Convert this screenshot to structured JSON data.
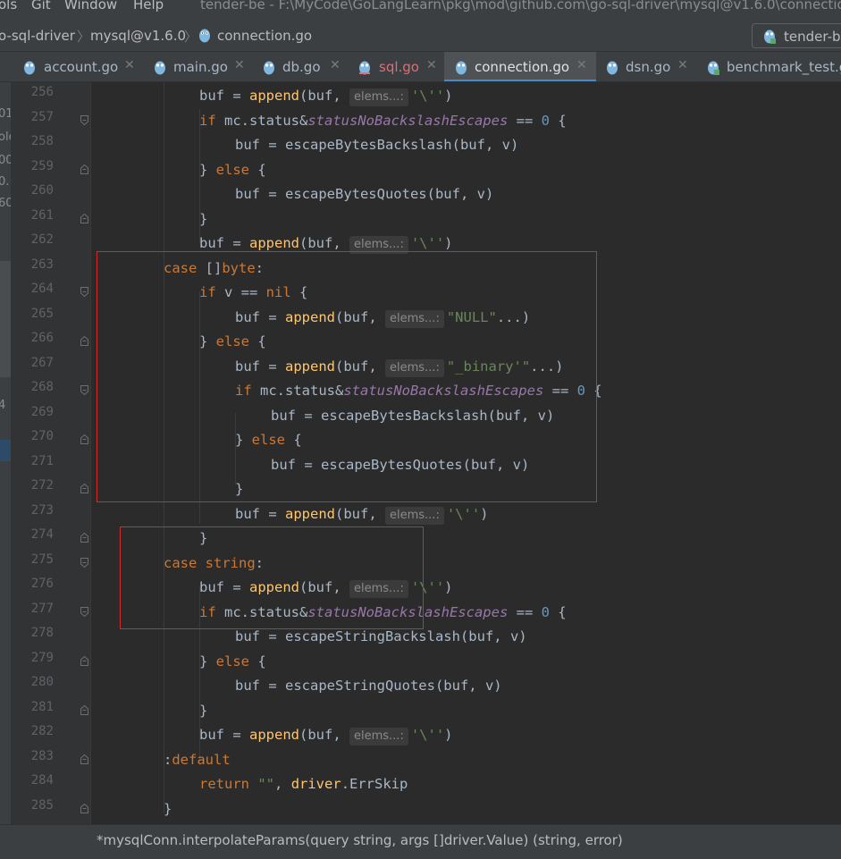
{
  "menu": {
    "items": [
      "ols",
      "Git",
      "Window",
      "Help"
    ],
    "window_title": "tender-be - F:\\MyCode\\GoLangLearn\\pkg\\mod\\github.com\\go-sql-driver\\mysql@v1.6.0\\connection.go"
  },
  "breadcrumb": {
    "items": [
      "o-sql-driver",
      "mysql@v1.6.0",
      "connection.go"
    ],
    "run_config": "tender-be"
  },
  "tabs": [
    {
      "label": "account.go",
      "active": false
    },
    {
      "label": "main.go",
      "active": false
    },
    {
      "label": "db.go",
      "active": false
    },
    {
      "label": "sql.go",
      "active": false,
      "error": true
    },
    {
      "label": "connection.go",
      "active": true
    },
    {
      "label": "dsn.go",
      "active": false
    },
    {
      "label": "benchmark_test.go",
      "active": false
    }
  ],
  "left_strip_fragments": [
    "01",
    "ole",
    "00",
    "0.",
    "60",
    "4"
  ],
  "line_numbers": [
    "256",
    "257",
    "258",
    "259",
    "260",
    "261",
    "262",
    "263",
    "264",
    "265",
    "266",
    "267",
    "268",
    "269",
    "270",
    "271",
    "272",
    "273",
    "274",
    "275",
    "276",
    "277",
    "278",
    "279",
    "280",
    "281",
    "282",
    "283",
    "284",
    "285"
  ],
  "inlay_hint": "elems...:",
  "code": {
    "l256": {
      "a": "buf = ",
      "fn": "append",
      "b": "(buf, ",
      "str": "'\\''",
      "c": ")"
    },
    "l257": {
      "kw": "if",
      "a": " mc.status&",
      "const": "statusNoBackslashEscapes",
      "b": " == ",
      "num": "0",
      "c": " {"
    },
    "l258": {
      "a": "buf = escapeBytesBackslash(buf, v)"
    },
    "l259": {
      "a": "} ",
      "kw": "else",
      "b": " {"
    },
    "l260": {
      "a": "buf = escapeBytesQuotes(buf, v)"
    },
    "l261": {
      "a": "}"
    },
    "l262": {
      "a": "buf = ",
      "fn": "append",
      "b": "(buf, ",
      "str": "'\\''",
      "c": ")"
    },
    "l263": {
      "kw": "case",
      "a": " []",
      "ty": "byte",
      "b": ":"
    },
    "l264": {
      "kw": "if",
      "a": " v == ",
      "kw2": "nil",
      "b": " {"
    },
    "l265": {
      "a": "buf = ",
      "fn": "append",
      "b": "(buf, ",
      "str": "\"NULL\"",
      "c": "...)"
    },
    "l266": {
      "a": "} ",
      "kw": "else",
      "b": " {"
    },
    "l267": {
      "a": "buf = ",
      "fn": "append",
      "b": "(buf, ",
      "str": "\"_binary'\"",
      "c": "...)"
    },
    "l268": {
      "kw": "if",
      "a": " mc.status&",
      "const": "statusNoBackslashEscapes",
      "b": " == ",
      "num": "0",
      "c": " {"
    },
    "l269": {
      "a": "buf = escapeBytesBackslash(buf, v)"
    },
    "l270": {
      "a": "} ",
      "kw": "else",
      "b": " {"
    },
    "l271": {
      "a": "buf = escapeBytesQuotes(buf, v)"
    },
    "l272": {
      "a": "}"
    },
    "l273": {
      "a": "buf = ",
      "fn": "append",
      "b": "(buf, ",
      "str": "'\\''",
      "c": ")"
    },
    "l274": {
      "a": "}"
    },
    "l275": {
      "kw": "case",
      "a": " ",
      "ty": "string",
      "b": ":"
    },
    "l276": {
      "a": "buf = ",
      "fn": "append",
      "b": "(buf, ",
      "str": "'\\''",
      "c": ")"
    },
    "l277": {
      "kw": "if",
      "a": " mc.status&",
      "const": "statusNoBackslashEscapes",
      "b": " == ",
      "num": "0",
      "c": " {"
    },
    "l278": {
      "a": "buf = escapeStringBackslash(buf, v)"
    },
    "l279": {
      "a": "} ",
      "kw": "else",
      "b": " {"
    },
    "l280": {
      "a": "buf = escapeStringQuotes(buf, v)"
    },
    "l281": {
      "a": "}"
    },
    "l282": {
      "a": "buf = ",
      "fn": "append",
      "b": "(buf, ",
      "str": "'\\''",
      "c": ")"
    },
    "l283": {
      "kw": "default",
      "a": ":"
    },
    "l284": {
      "kw": "return",
      "a": " ",
      "str": "\"\"",
      "b": ", ",
      "fn": "driver",
      "c": ".ErrSkip"
    },
    "l285": {
      "a": "}"
    }
  },
  "status": {
    "signature": "*mysqlConn.interpolateParams(query string, args []driver.Value) (string, error)"
  },
  "colors": {
    "editor_bg": "#2b2b2b",
    "keyword": "#cc7832",
    "function": "#ffc66d",
    "string": "#6a8759",
    "number": "#6897bb",
    "constant": "#9876aa",
    "annotation_box": "#d62a2a",
    "active_tab_underline": "#4a88c7"
  }
}
